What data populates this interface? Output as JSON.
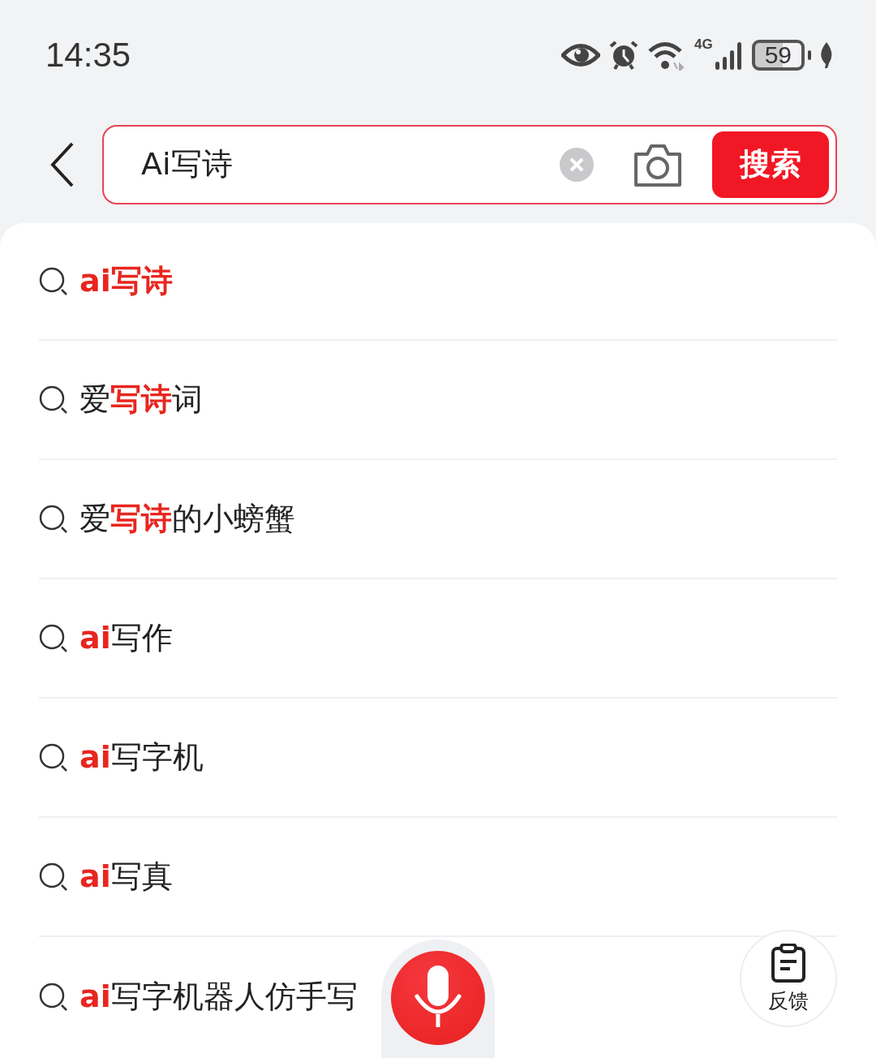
{
  "status_bar": {
    "time": "14:35",
    "network": "4G",
    "battery": "59"
  },
  "search": {
    "value": "Ai写诗",
    "button": "搜索"
  },
  "suggestions": [
    {
      "text": "**ai写诗**"
    },
    {
      "text": "爱**写诗**词"
    },
    {
      "text": "爱**写诗**的小螃蟹"
    },
    {
      "text": "**ai**写作"
    },
    {
      "text": "**ai**写字机"
    },
    {
      "text": "**ai**写真"
    },
    {
      "text": "**ai**写字机器人仿手写"
    }
  ],
  "feedback": {
    "label": "反馈"
  }
}
